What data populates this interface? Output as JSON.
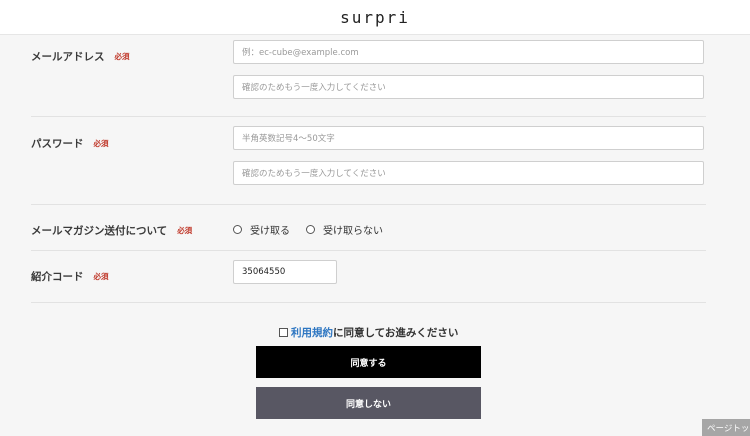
{
  "header": {
    "logo": "surpri"
  },
  "required_label": "必須",
  "email": {
    "label": "メールアドレス",
    "placeholder": "例：ec-cube@example.com",
    "confirm_placeholder": "確認のためもう一度入力してください"
  },
  "password": {
    "label": "パスワード",
    "placeholder": "半角英数記号4〜50文字",
    "confirm_placeholder": "確認のためもう一度入力してください"
  },
  "newsletter": {
    "label": "メールマガジン送付について",
    "options": [
      "受け取る",
      "受け取らない"
    ]
  },
  "referral": {
    "label": "紹介コード",
    "value": "35064550"
  },
  "agreement": {
    "link_text": "利用規約",
    "text": "に同意してお進みください"
  },
  "buttons": {
    "agree": "同意する",
    "decline": "同意しない"
  },
  "page_top": "ページトップ"
}
